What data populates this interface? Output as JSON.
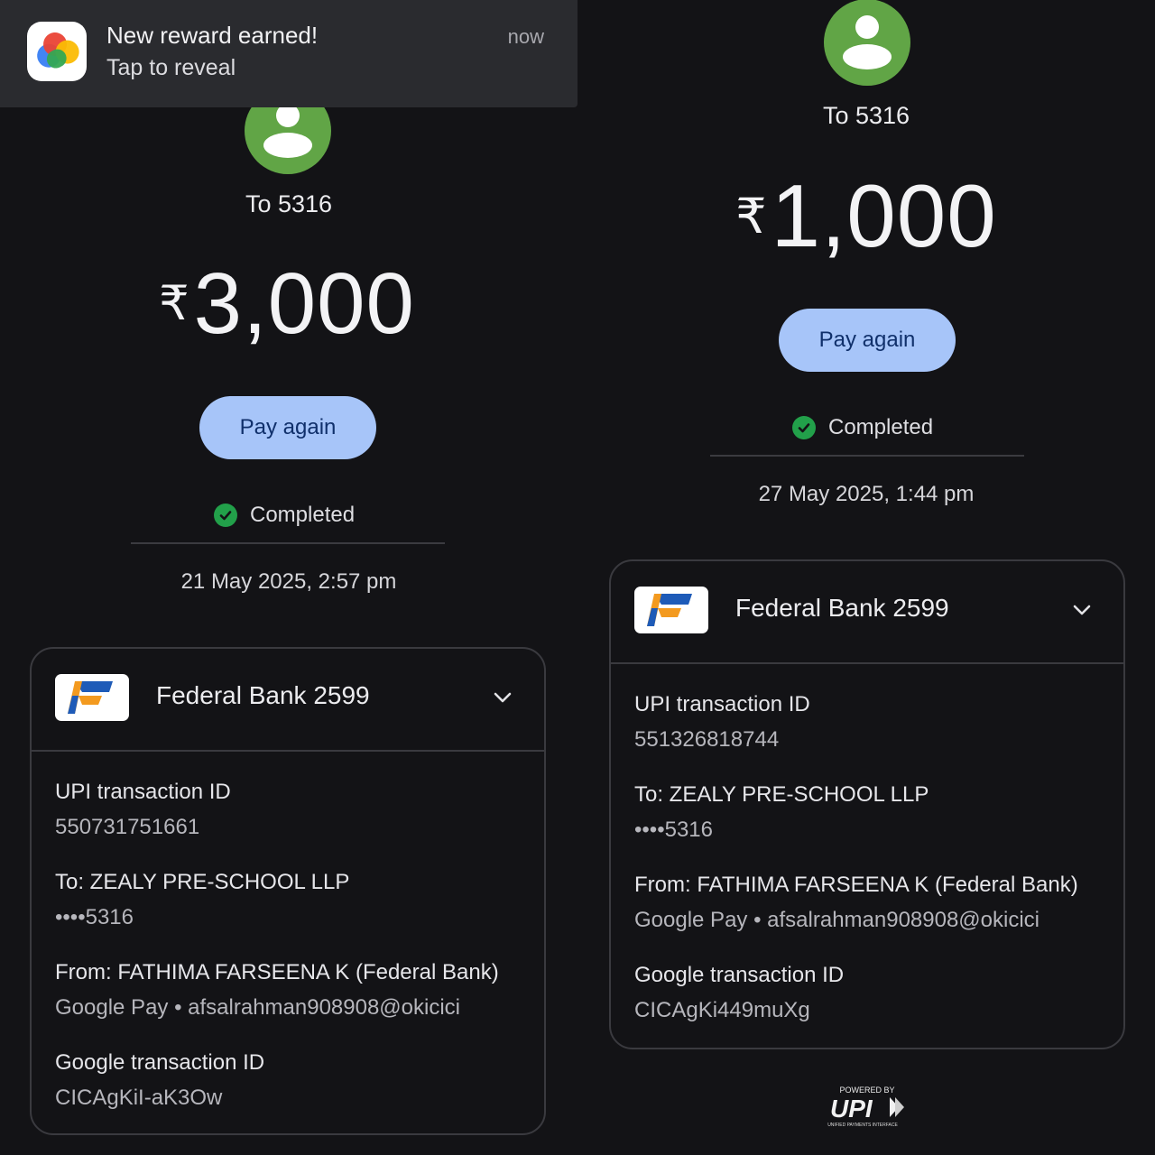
{
  "notification": {
    "title": "New reward earned!",
    "subtitle": "Tap to reveal",
    "time": "now",
    "app_icon": "google-pay-icon"
  },
  "left": {
    "recipient": "To 5316",
    "currency": "₹",
    "amount": "3,000",
    "pay_again_label": "Pay again",
    "status": "Completed",
    "date": "21 May 2025, 2:57 pm",
    "card": {
      "bank_name": "Federal Bank 2599",
      "upi_label": "UPI transaction ID",
      "upi_value": "550731751661",
      "to_label": "To: ZEALY PRE-SCHOOL LLP",
      "to_value": "••••5316",
      "from_label": "From: FATHIMA FARSEENA K (Federal Bank)",
      "from_value": "Google Pay • afsalrahman908908@okicici",
      "google_label": "Google transaction ID",
      "google_value": "CICAgKiI-aK3Ow"
    }
  },
  "right": {
    "recipient": "To 5316",
    "currency": "₹",
    "amount": "1,000",
    "pay_again_label": "Pay again",
    "status": "Completed",
    "date": "27 May 2025, 1:44 pm",
    "card": {
      "bank_name": "Federal Bank 2599",
      "upi_label": "UPI transaction ID",
      "upi_value": "551326818744",
      "to_label": "To: ZEALY PRE-SCHOOL LLP",
      "to_value": "••••5316",
      "from_label": "From: FATHIMA FARSEENA K (Federal Bank)",
      "from_value": "Google Pay • afsalrahman908908@okicici",
      "google_label": "Google transaction ID",
      "google_value": "CICAgKi449muXg"
    }
  },
  "footer": {
    "powered_by": "POWERED BY",
    "upi_wordmark": "UPI",
    "upi_tagline": "UNIFIED PAYMENTS INTERFACE"
  },
  "colors": {
    "background": "#131316",
    "avatar": "#61a546",
    "pay_button": "#a7c5f9",
    "pay_button_text": "#10306b",
    "completed": "#22a04a"
  }
}
